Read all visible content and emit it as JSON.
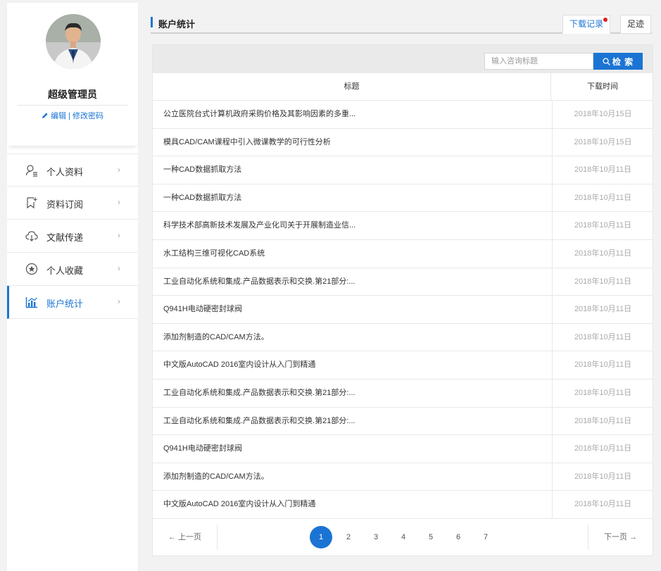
{
  "colors": {
    "accent": "#1b74d3",
    "badge": "#e02020"
  },
  "profile": {
    "name": "超级管理员",
    "edit_label": "编辑",
    "separator": " | ",
    "change_password_label": "修改密码"
  },
  "nav": {
    "items": [
      {
        "label": "个人资料",
        "icon": "user-list-icon",
        "chevron": "›"
      },
      {
        "label": "资料订阅",
        "icon": "bookmark-plus-icon",
        "chevron": "›"
      },
      {
        "label": "文献传递",
        "icon": "cloud-download-icon",
        "chevron": "›"
      },
      {
        "label": "个人收藏",
        "icon": "star-circle-icon",
        "chevron": "›"
      },
      {
        "label": "账户统计",
        "icon": "bar-chart-icon",
        "chevron": "›",
        "active": true
      }
    ]
  },
  "header": {
    "title": "账户统计"
  },
  "tabs": {
    "download": "下载记录",
    "trace": "足迹"
  },
  "search": {
    "placeholder": "输入咨询标题",
    "button_label": "检 索"
  },
  "table": {
    "headers": {
      "title": "标题",
      "time": "下载时间"
    },
    "rows": [
      {
        "title": "公立医院台式计算机政府采购价格及其影响因素的多重...",
        "time": "2018年10月15日"
      },
      {
        "title": "模具CAD/CAM课程中引入微课教学的可行性分析",
        "time": "2018年10月15日"
      },
      {
        "title": "一种CAD数据抓取方法",
        "time": "2018年10月11日"
      },
      {
        "title": "一种CAD数据抓取方法",
        "time": "2018年10月11日"
      },
      {
        "title": "科学技术部高新技术发展及产业化司关于开展制造业信...",
        "time": "2018年10月11日"
      },
      {
        "title": "水工结构三维可视化CAD系统",
        "time": "2018年10月11日"
      },
      {
        "title": "工业自动化系统和集成.产品数据表示和交换.第21部分:...",
        "time": "2018年10月11日"
      },
      {
        "title": "Q941H电动硬密封球阀",
        "time": "2018年10月11日"
      },
      {
        "title": "添加剂制造的CAD/CAM方法。",
        "time": "2018年10月11日"
      },
      {
        "title": "中文版AutoCAD 2016室内设计从入门到精通",
        "time": "2018年10月11日"
      },
      {
        "title": "工业自动化系统和集成.产品数据表示和交换.第21部分:...",
        "time": "2018年10月11日"
      },
      {
        "title": "工业自动化系统和集成.产品数据表示和交换.第21部分:...",
        "time": "2018年10月11日"
      },
      {
        "title": "Q941H电动硬密封球阀",
        "time": "2018年10月11日"
      },
      {
        "title": "添加剂制造的CAD/CAM方法。",
        "time": "2018年10月11日"
      },
      {
        "title": "中文版AutoCAD 2016室内设计从入门到精通",
        "time": "2018年10月11日"
      }
    ]
  },
  "pagination": {
    "prev_label": "← 上一页",
    "next_label": "下一页 →",
    "pages": [
      "1",
      "2",
      "3",
      "4",
      "5",
      "6",
      "7"
    ],
    "current": "1"
  }
}
